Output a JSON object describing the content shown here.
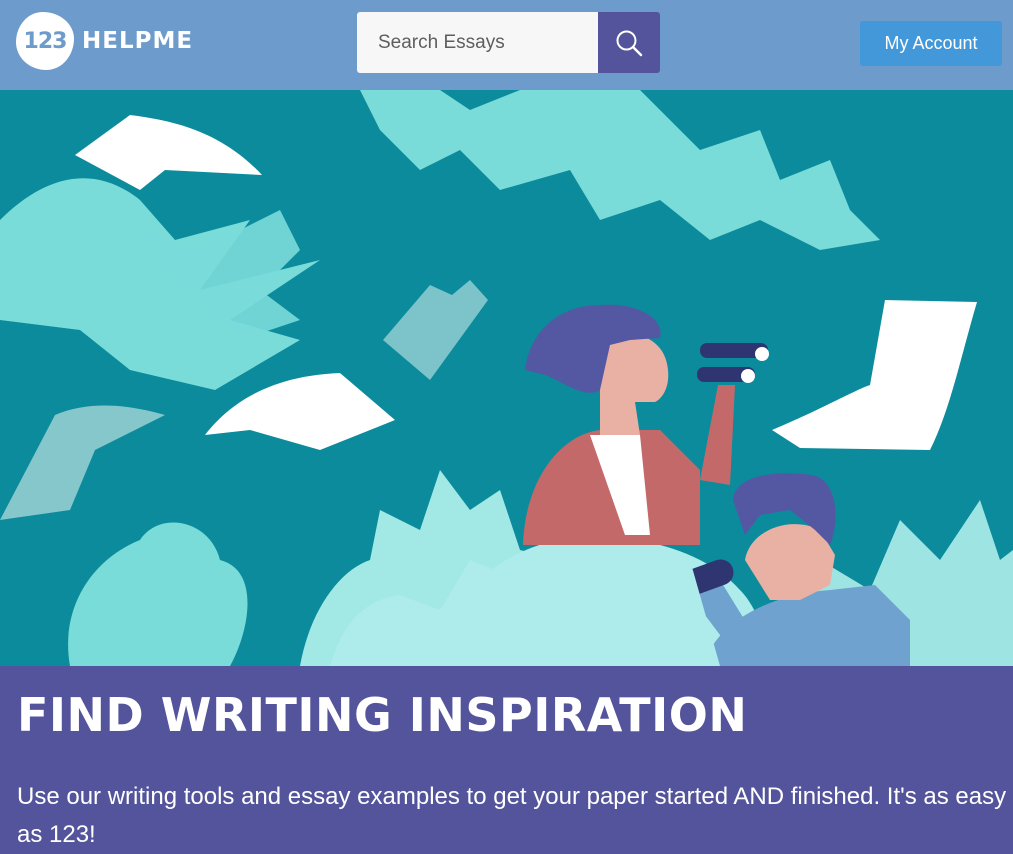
{
  "header": {
    "logo_number": "123",
    "logo_text": "HELPME",
    "search": {
      "placeholder": "Search Essays",
      "icon": "search-icon"
    },
    "account_label": "My Account"
  },
  "hero": {
    "illustration": "two-people-with-binoculars-and-telescope-in-jungle"
  },
  "banner": {
    "title": "FIND WRITING INSPIRATION",
    "text": "Use our writing tools and essay examples to get your paper started AND finished. It's as easy as 123!"
  },
  "colors": {
    "header_bg": "#6d9bcb",
    "search_button": "#53549c",
    "account_button": "#4298d8",
    "hero_bg": "#0b8b9c",
    "banner_bg": "#54549c"
  }
}
